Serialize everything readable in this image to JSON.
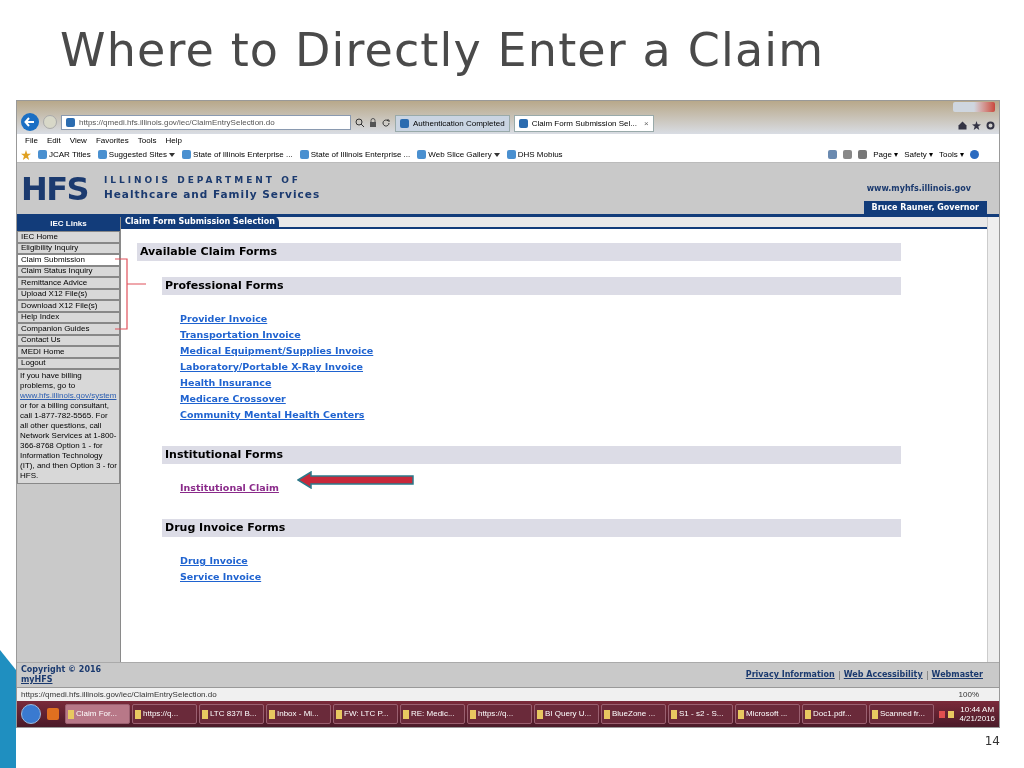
{
  "slide": {
    "title": "Where to Directly Enter a Claim",
    "page_number": "14"
  },
  "browser": {
    "address": "https://qmedi.hfs.illinois.gov/iec/ClaimEntrySelection.do",
    "tabs": [
      {
        "label": "Authentication Completed",
        "selected": false
      },
      {
        "label": "Claim Form Submission Sel...",
        "selected": true
      }
    ],
    "tab_close": "×",
    "menu": [
      "File",
      "Edit",
      "View",
      "Favorites",
      "Tools",
      "Help"
    ],
    "favorites": [
      {
        "label": "JCAR Titles",
        "dropdown": false
      },
      {
        "label": "Suggested Sites",
        "dropdown": true
      },
      {
        "label": "State of Illinois Enterprise ...",
        "dropdown": false
      },
      {
        "label": "State of Illinois Enterprise ...",
        "dropdown": false
      },
      {
        "label": "Web Slice Gallery",
        "dropdown": true
      },
      {
        "label": "DHS Mobius",
        "dropdown": false
      }
    ],
    "command_bar": [
      "Page ▾",
      "Safety ▾",
      "Tools ▾"
    ],
    "status_url": "https://qmedi.hfs.illinois.gov/iec/ClaimEntrySelection.do",
    "zoom": "100%"
  },
  "header": {
    "logo": "HFS",
    "org_line1": "ILLINOIS DEPARTMENT OF",
    "org_line2": "Healthcare and Family Services",
    "site_url": "www.myhfs.illinois.gov",
    "governor": "Bruce Rauner, Governor"
  },
  "sidebar": {
    "heading": "IEC Links",
    "items": [
      {
        "label": "IEC Home",
        "selected": false
      },
      {
        "label": "Eligibility Inquiry",
        "selected": false
      },
      {
        "label": "Claim Submission",
        "selected": true
      },
      {
        "label": "Claim Status Inquiry",
        "selected": false
      },
      {
        "label": "Remittance Advice",
        "selected": false
      },
      {
        "label": "Upload X12 File(s)",
        "selected": false
      },
      {
        "label": "Download X12 File(s)",
        "selected": false
      },
      {
        "label": "Help Index",
        "selected": false
      },
      {
        "label": "Companion Guides",
        "selected": false
      },
      {
        "label": "Contact Us",
        "selected": false
      },
      {
        "label": "MEDI Home",
        "selected": false
      },
      {
        "label": "Logout",
        "selected": false
      }
    ],
    "help_before": "If you have billing problems, go to",
    "help_link": "www.hfs.illinois.gov/system",
    "help_after": "or for a billing consultant, call 1-877-782-5565. For all other questions, call Network Services at 1-800-366-8768 Option 1 - for Information Technology (IT), and then Option 3 - for HFS."
  },
  "main": {
    "breadcrumb": "Claim Form Submission Selection",
    "heading": "Available Claim Forms",
    "sections": [
      {
        "title": "Professional Forms",
        "links": [
          {
            "label": "Provider Invoice",
            "visited": false
          },
          {
            "label": "Transportation Invoice",
            "visited": false
          },
          {
            "label": "Medical Equipment/Supplies Invoice",
            "visited": false
          },
          {
            "label": "Laboratory/Portable X-Ray Invoice",
            "visited": false
          },
          {
            "label": "Health Insurance",
            "visited": false
          },
          {
            "label": "Medicare Crossover",
            "visited": false
          },
          {
            "label": "Community Mental Health Centers",
            "visited": false
          }
        ]
      },
      {
        "title": "Institutional Forms",
        "links": [
          {
            "label": "Institutional Claim",
            "visited": true
          }
        ]
      },
      {
        "title": "Drug Invoice Forms",
        "links": [
          {
            "label": "Drug Invoice",
            "visited": false
          },
          {
            "label": "Service Invoice",
            "visited": false
          }
        ]
      }
    ]
  },
  "footer": {
    "copyright": "Copyright © 2016",
    "copyright_link": "myHFS",
    "links": [
      "Privacy Information",
      "Web Accessibility",
      "Webmaster"
    ]
  },
  "taskbar": {
    "items": [
      {
        "label": "Claim For...",
        "active": true
      },
      {
        "label": "https://q...",
        "active": false
      },
      {
        "label": "LTC 837I B...",
        "active": false
      },
      {
        "label": "Inbox - Mi...",
        "active": false
      },
      {
        "label": "FW: LTC P...",
        "active": false
      },
      {
        "label": "RE: Medic...",
        "active": false
      },
      {
        "label": "https://q...",
        "active": false
      },
      {
        "label": "BI Query U...",
        "active": false
      },
      {
        "label": "BlueZone ...",
        "active": false
      },
      {
        "label": "S1 - s2 - S...",
        "active": false
      },
      {
        "label": "Microsoft ...",
        "active": false
      },
      {
        "label": "Doc1.pdf...",
        "active": false
      },
      {
        "label": "Scanned fr...",
        "active": false
      }
    ],
    "time": "10:44 AM",
    "date": "4/21/2016"
  }
}
